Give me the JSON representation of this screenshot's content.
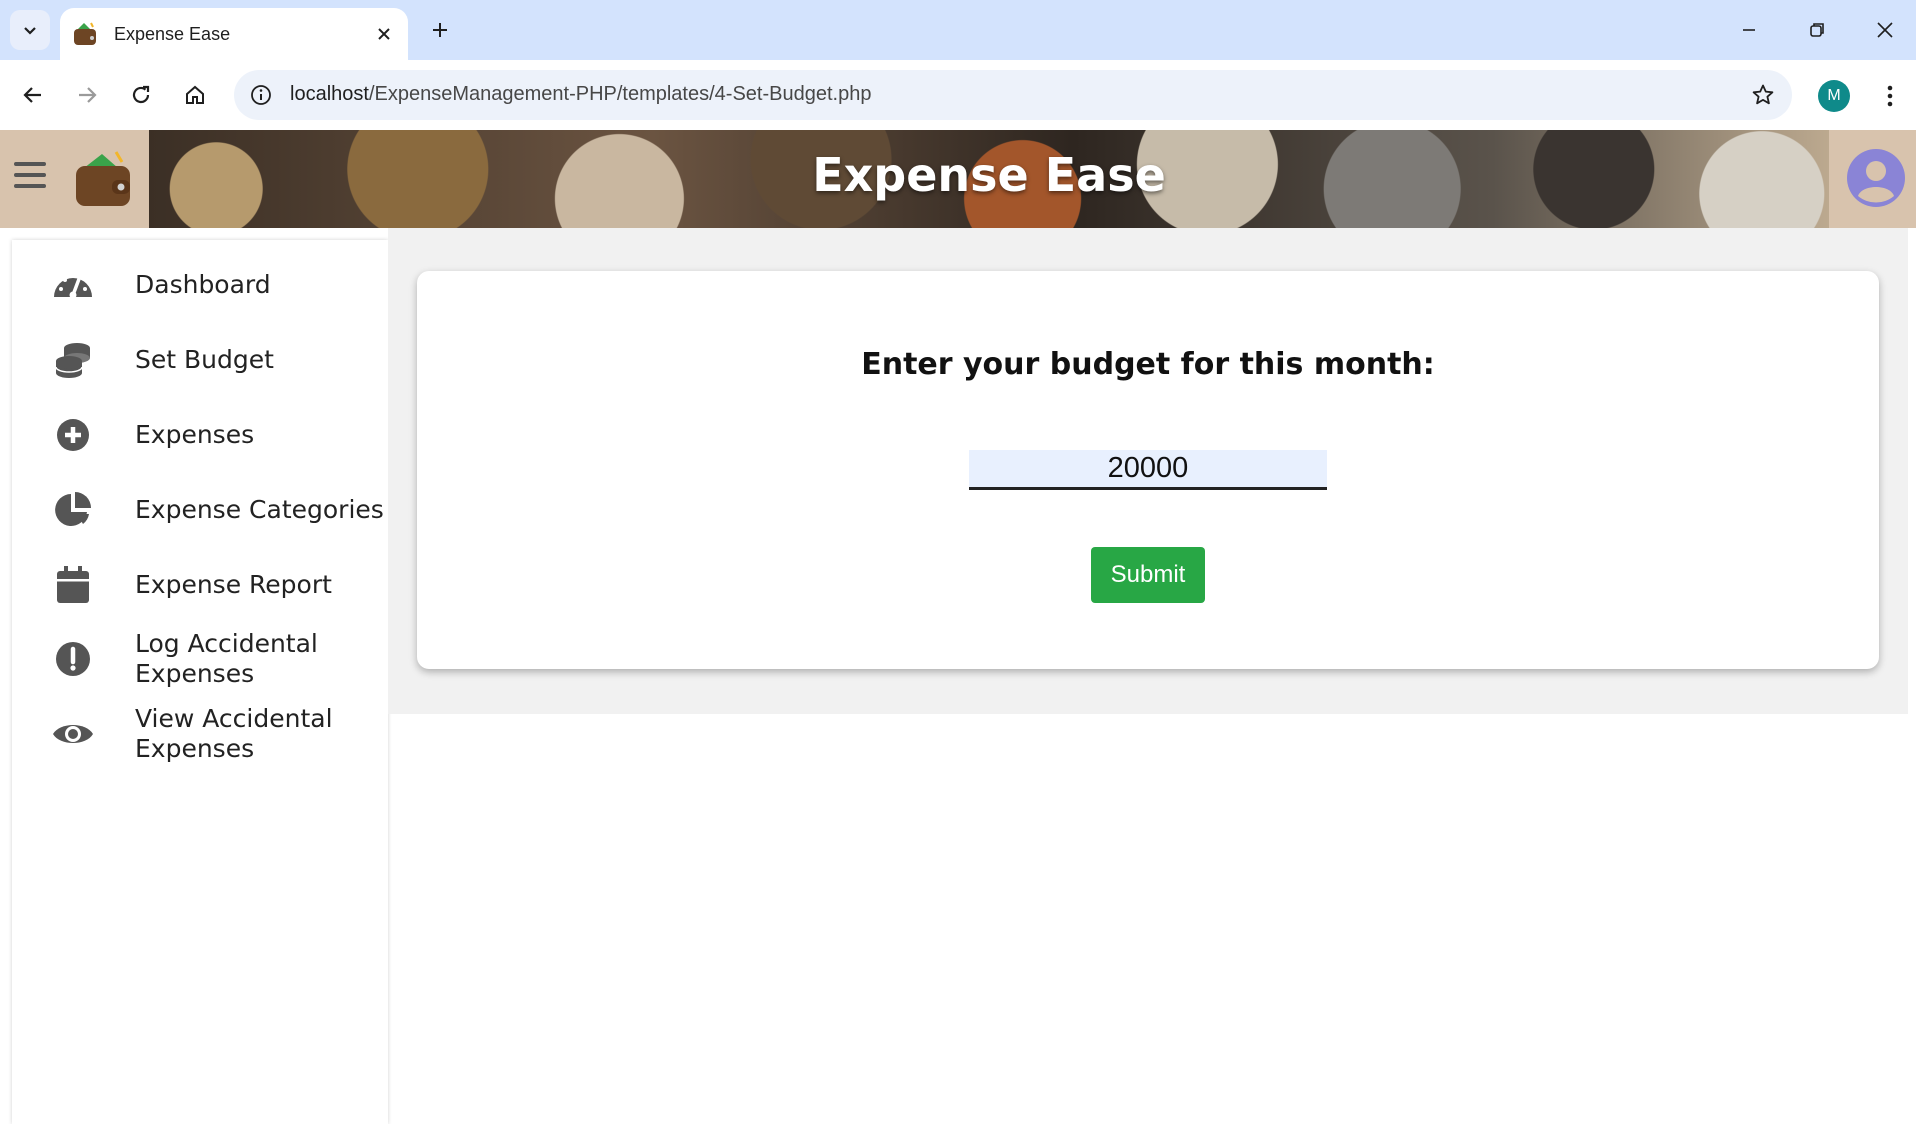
{
  "browser": {
    "tab_title": "Expense Ease",
    "url_host": "localhost",
    "url_path": "/ExpenseManagement-PHP/templates/4-Set-Budget.php",
    "profile_initial": "M",
    "icons": [
      "chevron-down-icon",
      "close-icon",
      "plus-icon",
      "minimize-icon",
      "restore-icon",
      "back-icon",
      "forward-icon",
      "reload-icon",
      "home-icon",
      "info-icon",
      "star-icon",
      "more-vert-icon"
    ]
  },
  "header": {
    "title": "Expense Ease",
    "icons": [
      "hamburger-icon",
      "wallet-logo",
      "user-avatar-icon"
    ]
  },
  "sidebar": {
    "items": [
      {
        "label": "Dashboard",
        "icon": "speedometer-icon"
      },
      {
        "label": "Set Budget",
        "icon": "coins-icon"
      },
      {
        "label": "Expenses",
        "icon": "plus-circle-icon"
      },
      {
        "label": "Expense Categories",
        "icon": "pie-chart-icon"
      },
      {
        "label": "Expense Report",
        "icon": "calendar-icon"
      },
      {
        "label": "Log Accidental Expenses",
        "icon": "exclamation-circle-icon"
      },
      {
        "label": "View Accidental Expenses",
        "icon": "eye-icon"
      }
    ]
  },
  "main": {
    "prompt": "Enter your budget for this month:",
    "budget_value": "20000",
    "submit_label": "Submit"
  },
  "colors": {
    "tabstrip": "#d3e3fd",
    "submit": "#28a745",
    "input_bg": "#e8f0fe",
    "content_bg": "#f1f1f1",
    "header_bg": "#d8c3ad"
  }
}
